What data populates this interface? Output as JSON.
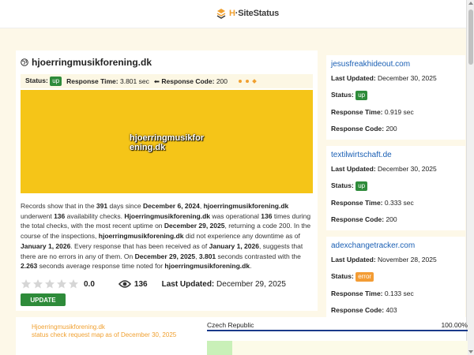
{
  "header": {
    "logo_h": "H",
    "logo_rest": "·SiteStatus"
  },
  "main": {
    "title": "hjoerringmusikforening.dk",
    "status_label": "Status:",
    "status_value": "up",
    "response_time_label": "Response Time:",
    "response_time_value": "3.801 sec",
    "response_code_label": "Response Code:",
    "response_code_value": "200",
    "preview_text": "hjoerringmusikforening.dk",
    "desc": {
      "p1": "Records show that in the ",
      "days": "391",
      "p2": " days since ",
      "since": "December 6, 2024",
      "p3": ", ",
      "domain1": "hjoerringmusikforening.dk",
      "p4": " underwent ",
      "checks": "136",
      "p5": " availability checks. ",
      "domain2": "Hjoerringmusikforening.dk",
      "p6": " was operational ",
      "times": "136",
      "p7": " times during the total checks, with the most recent uptime on ",
      "recent": "December 29, 2025",
      "p8": ", returning a code 200. In the course of the inspections, ",
      "domain3": "hjoerringmusikforening.dk",
      "p9": " did not experience any downtime as of ",
      "asof": "January 1, 2026",
      "p10": ". Every response that has been received as of ",
      "asof2": "January 1, 2026",
      "p11": ", suggests that there are no errors in any of them. On ",
      "on": "December 29, 2025",
      "p12": ", ",
      "secs": "3.801",
      "p13": " seconds contrasted with the ",
      "avg": "2.263",
      "p14": " seconds average response time noted for ",
      "domain4": "hjoerringmusikforening.dk",
      "p15": "."
    },
    "rating": "0.0",
    "rating_stars": 0,
    "views": "136",
    "last_updated_label": "Last Updated:",
    "last_updated_value": "December 29, 2025",
    "update_button": "UPDATE"
  },
  "sidebar": [
    {
      "domain": "jesusfreakhideout.com",
      "last_updated_label": "Last Updated:",
      "last_updated": "December 30, 2025",
      "status_label": "Status:",
      "status": "up",
      "rt_label": "Response Time:",
      "rt": "0.919 sec",
      "rc_label": "Response Code:",
      "rc": "200"
    },
    {
      "domain": "textilwirtschaft.de",
      "last_updated_label": "Last Updated:",
      "last_updated": "December 30, 2025",
      "status_label": "Status:",
      "status": "up",
      "rt_label": "Response Time:",
      "rt": "0.333 sec",
      "rc_label": "Response Code:",
      "rc": "200"
    },
    {
      "domain": "adexchangetracker.com",
      "last_updated_label": "Last Updated:",
      "last_updated": "November 28, 2025",
      "status_label": "Status:",
      "status": "error",
      "rt_label": "Response Time:",
      "rt": "0.133 sec",
      "rc_label": "Response Code:",
      "rc": "403"
    }
  ],
  "map": {
    "label_line1": "Hjoerringmusikforening.dk",
    "label_line2": "status check request map as of December 30, 2025",
    "country": "Czech Republic",
    "percent": "100.00%"
  },
  "colors": {
    "accent": "#f0a030",
    "up": "#2e8b3a",
    "error": "#f39c34",
    "link": "#1a5fb4",
    "preview_bg": "#f5c518"
  }
}
